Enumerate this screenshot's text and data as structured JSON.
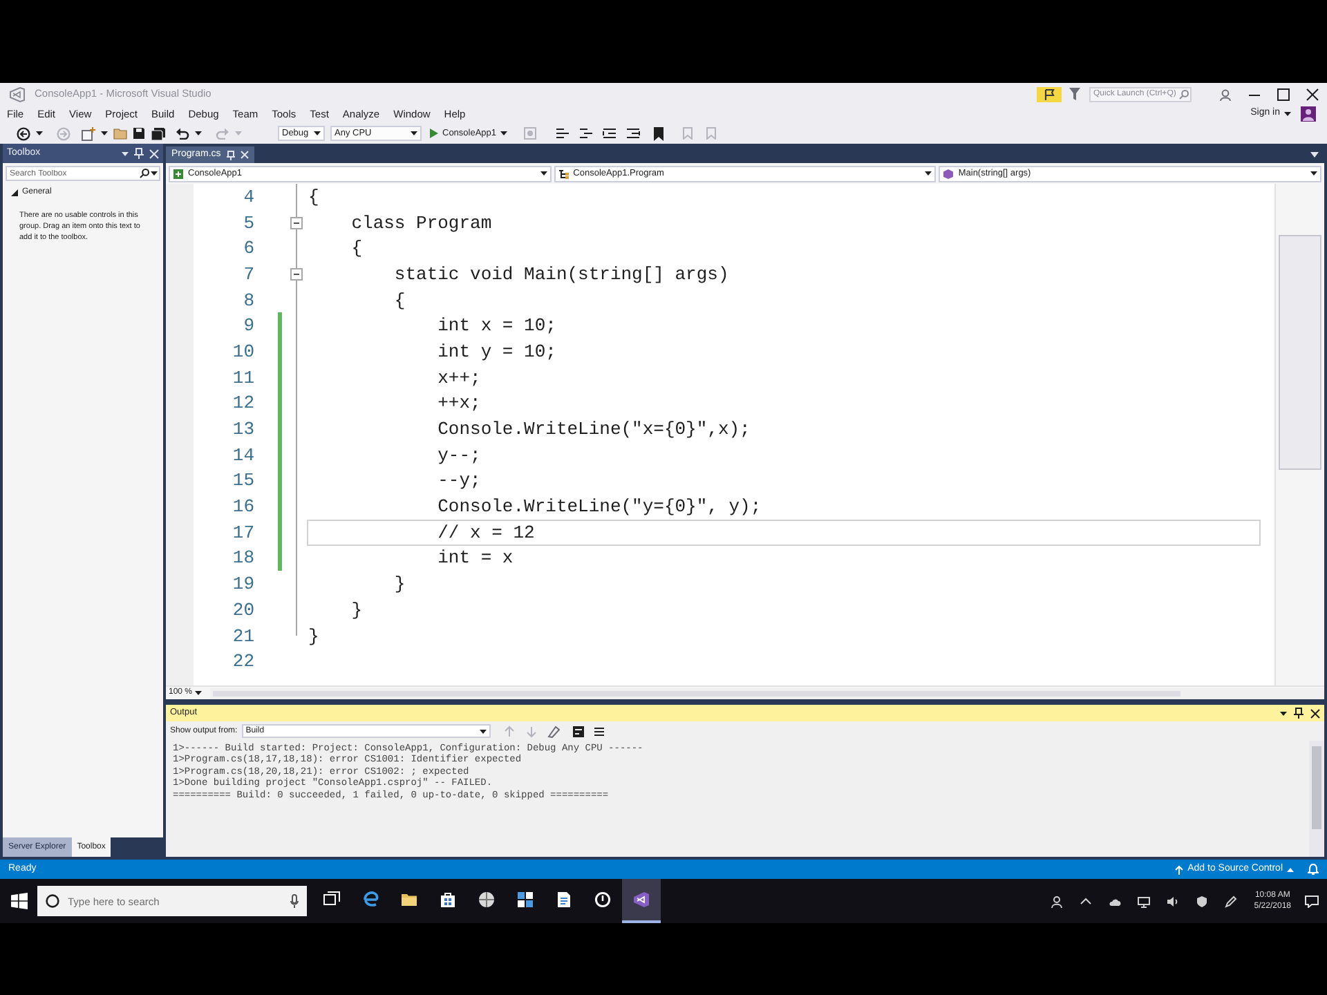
{
  "window": {
    "title": "ConsoleApp1 - Microsoft Visual Studio",
    "quick_launch": {
      "placeholder": "Quick Launch (Ctrl+Q)"
    },
    "account": "Sign in"
  },
  "menu": [
    "File",
    "Edit",
    "View",
    "Project",
    "Build",
    "Debug",
    "Team",
    "Tools",
    "Test",
    "Analyze",
    "Window",
    "Help"
  ],
  "toolbar": {
    "configuration": "Debug",
    "platform": "Any CPU",
    "start": "ConsoleApp1"
  },
  "toolbox": {
    "title": "Toolbox",
    "search": {
      "placeholder": "Search Toolbox"
    },
    "group": {
      "label": "General",
      "expanded": true
    },
    "message": "There are no usable controls in this group. Drag an item onto this text to add it to the toolbox.",
    "tabs": [
      {
        "label": "Server Explorer",
        "selected": false
      },
      {
        "label": "Toolbox",
        "selected": true
      }
    ]
  },
  "editor": {
    "tabs": [
      {
        "label": "Program.cs",
        "selected": true
      }
    ],
    "navigation": [
      "ConsoleApp1",
      "ConsoleApp1.Program",
      "Main(string[] args)"
    ],
    "lines": [
      {
        "number": "4",
        "code": "{",
        "changed": false,
        "fold": false,
        "current": false
      },
      {
        "number": "5",
        "code": "    class Program",
        "changed": false,
        "fold": true,
        "current": false
      },
      {
        "number": "6",
        "code": "    {",
        "changed": false,
        "fold": false,
        "current": false
      },
      {
        "number": "7",
        "code": "        static void Main(string[] args)",
        "changed": false,
        "fold": true,
        "current": false
      },
      {
        "number": "8",
        "code": "        {",
        "changed": false,
        "fold": false,
        "current": false
      },
      {
        "number": "9",
        "code": "            int x = 10;",
        "changed": true,
        "fold": false,
        "current": false
      },
      {
        "number": "10",
        "code": "            int y = 10;",
        "changed": true,
        "fold": false,
        "current": false
      },
      {
        "number": "11",
        "code": "            x++;",
        "changed": true,
        "fold": false,
        "current": false
      },
      {
        "number": "12",
        "code": "            ++x;",
        "changed": true,
        "fold": false,
        "current": false
      },
      {
        "number": "13",
        "code": "            Console.WriteLine(\"x={0}\",x);",
        "changed": true,
        "fold": false,
        "current": false
      },
      {
        "number": "14",
        "code": "            y--;",
        "changed": true,
        "fold": false,
        "current": false
      },
      {
        "number": "15",
        "code": "            --y;",
        "changed": true,
        "fold": false,
        "current": false
      },
      {
        "number": "16",
        "code": "            Console.WriteLine(\"y={0}\", y);",
        "changed": true,
        "fold": false,
        "current": false
      },
      {
        "number": "17",
        "code": "            // x = 12",
        "changed": true,
        "fold": false,
        "current": true
      },
      {
        "number": "18",
        "code": "            int = x",
        "changed": true,
        "fold": false,
        "current": false
      },
      {
        "number": "19",
        "code": "        }",
        "changed": false,
        "fold": false,
        "current": false
      },
      {
        "number": "20",
        "code": "    }",
        "changed": false,
        "fold": false,
        "current": false
      },
      {
        "number": "21",
        "code": "}",
        "changed": false,
        "fold": false,
        "current": false
      },
      {
        "number": "22",
        "changed": false,
        "fold": false,
        "current": false
      }
    ],
    "zoom": "100 %"
  },
  "output": {
    "title": "Output",
    "source_label": "Show output from:",
    "source": "Build",
    "lines": [
      "1>------ Build started: Project: ConsoleApp1, Configuration: Debug Any CPU ------",
      "1>Program.cs(18,17,18,18): error CS1001: Identifier expected",
      "1>Program.cs(18,20,18,21): error CS1002: ; expected",
      "1>Done building project \"ConsoleApp1.csproj\" -- FAILED.",
      "========== Build: 0 succeeded, 1 failed, 0 up-to-date, 0 skipped =========="
    ]
  },
  "status_bar": {
    "text": "Ready",
    "source_control": "Add to Source Control"
  },
  "taskbar": {
    "search": {
      "placeholder": "Type here to search"
    },
    "apps": [
      {
        "kind": "task-view",
        "selected": false
      },
      {
        "kind": "browser",
        "selected": false
      },
      {
        "kind": "folder",
        "selected": false
      },
      {
        "kind": "store",
        "selected": false
      },
      {
        "kind": "globe",
        "selected": false
      },
      {
        "kind": "tiles",
        "selected": false
      },
      {
        "kind": "document",
        "selected": false
      },
      {
        "kind": "power",
        "selected": false
      },
      {
        "kind": "logo",
        "selected": true
      }
    ],
    "clock": {
      "time": "10:08 AM",
      "date": "5/22/2018"
    }
  }
}
